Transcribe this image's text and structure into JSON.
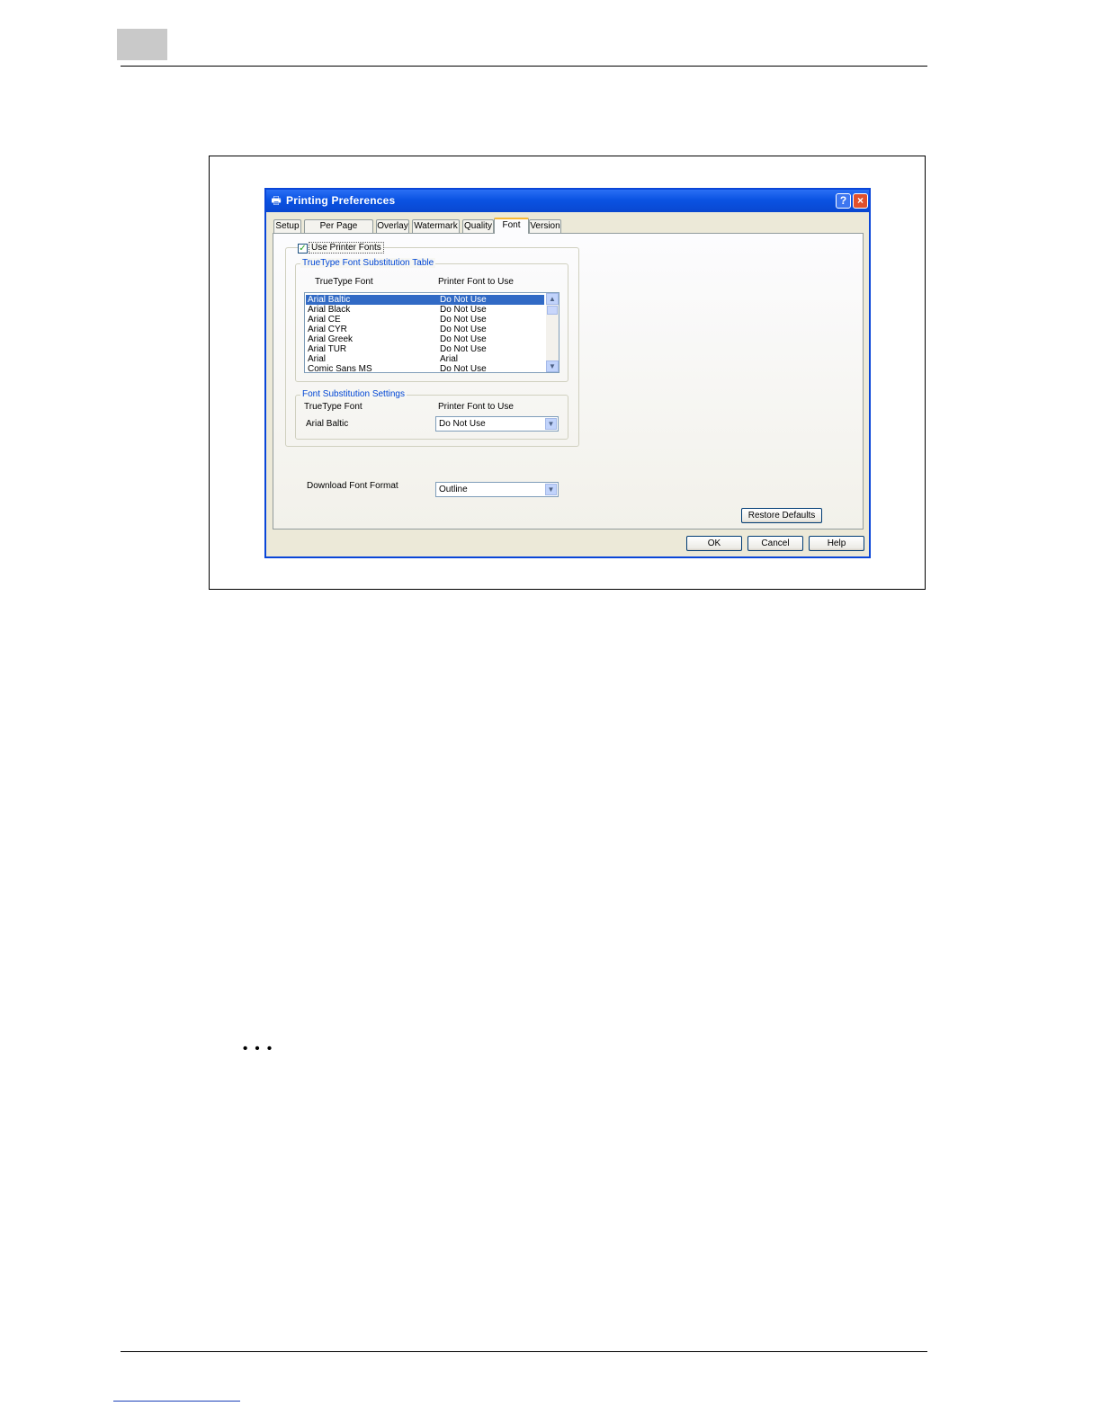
{
  "dialog": {
    "title": "Printing Preferences",
    "help_btn": "?",
    "close_btn": "×",
    "tabs": [
      {
        "label": "Setup"
      },
      {
        "label": "Per Page Setting"
      },
      {
        "label": "Overlay"
      },
      {
        "label": "Watermark"
      },
      {
        "label": "Quality"
      },
      {
        "label": "Font"
      },
      {
        "label": "Version"
      }
    ],
    "active_tab": "Font",
    "use_printer_fonts": {
      "label": "Use Printer Fonts",
      "checked": true
    },
    "substitution_table": {
      "legend": "TrueType Font Substitution Table",
      "col1": "TrueType Font",
      "col2": "Printer Font to Use",
      "rows": [
        {
          "font": "Arial Baltic",
          "printer_font": "Do Not Use"
        },
        {
          "font": "Arial Black",
          "printer_font": "Do Not Use"
        },
        {
          "font": "Arial CE",
          "printer_font": "Do Not Use"
        },
        {
          "font": "Arial CYR",
          "printer_font": "Do Not Use"
        },
        {
          "font": "Arial Greek",
          "printer_font": "Do Not Use"
        },
        {
          "font": "Arial TUR",
          "printer_font": "Do Not Use"
        },
        {
          "font": "Arial",
          "printer_font": "Arial"
        },
        {
          "font": "Comic Sans MS",
          "printer_font": "Do Not Use"
        }
      ]
    },
    "substitution_settings": {
      "legend": "Font Substitution Settings",
      "col1": "TrueType Font",
      "col2": "Printer Font to Use",
      "font": "Arial Baltic",
      "printer_font": "Do Not Use"
    },
    "download_format": {
      "label": "Download Font Format",
      "value": "Outline"
    },
    "buttons": {
      "restore": "Restore Defaults",
      "ok": "OK",
      "cancel": "Cancel",
      "help": "Help"
    }
  },
  "page": {
    "ellipsis": "• • •"
  },
  "colors": {
    "titlebar": "#0b53e3",
    "selection": "#316ac5",
    "legend": "#0046d5"
  }
}
